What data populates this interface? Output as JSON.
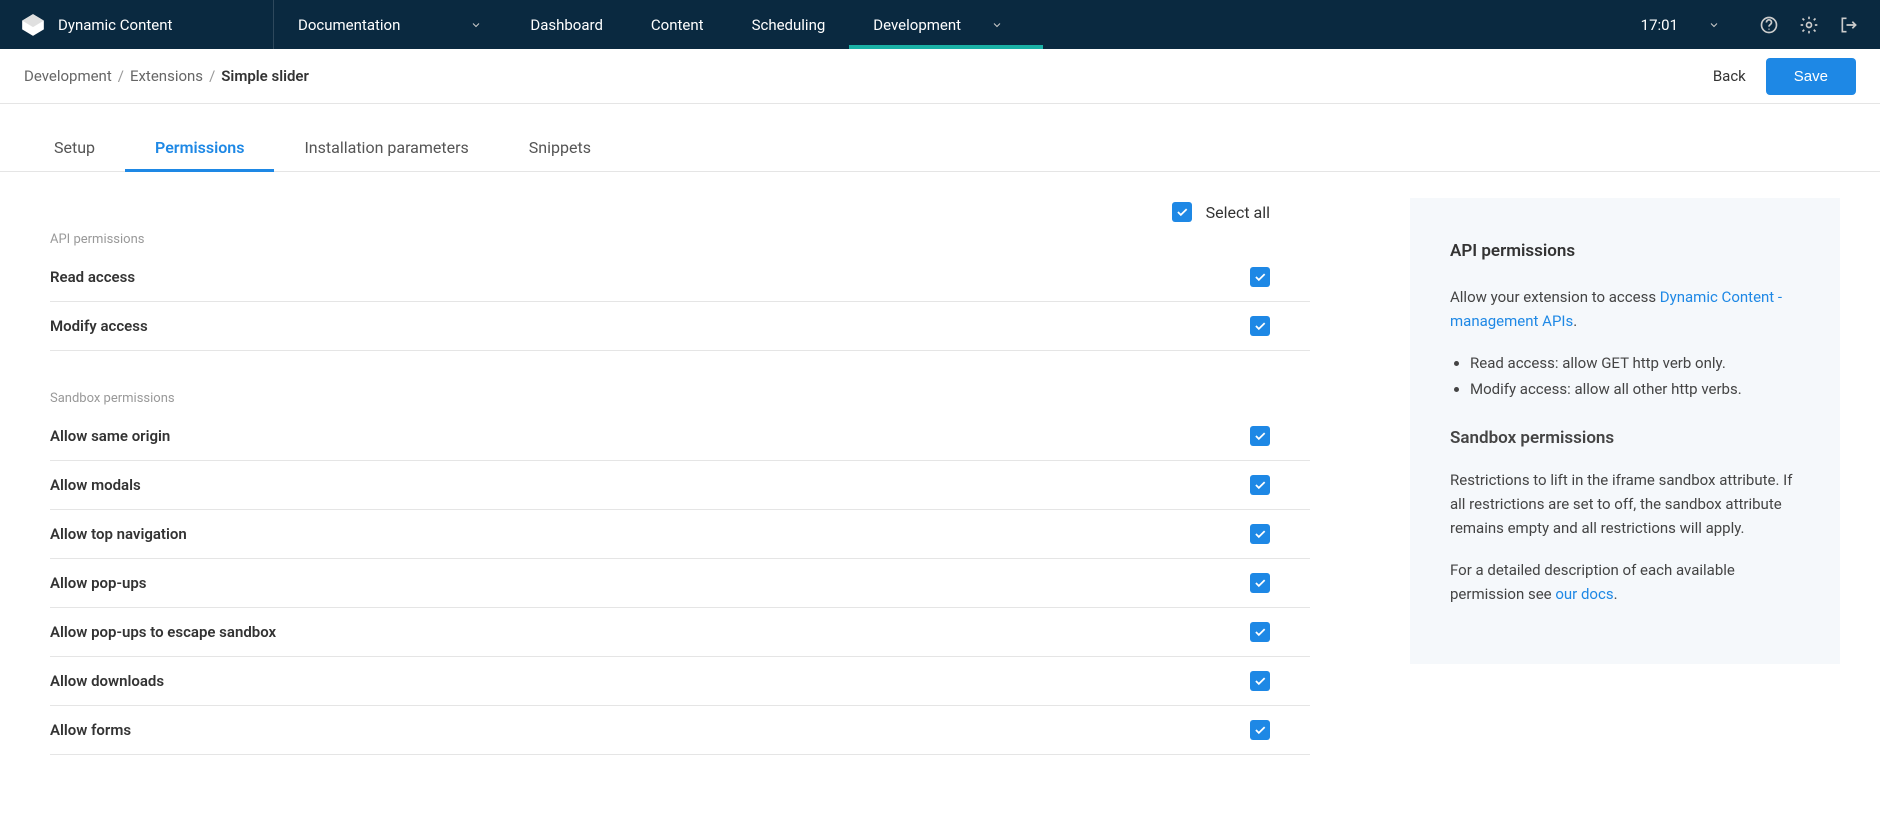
{
  "brand": "Dynamic Content",
  "docDropdown": "Documentation",
  "nav": {
    "items": [
      "Dashboard",
      "Content",
      "Scheduling",
      "Development"
    ],
    "activeIndex": 3
  },
  "time": "17:01",
  "breadcrumb": {
    "items": [
      "Development",
      "Extensions"
    ],
    "current": "Simple slider"
  },
  "actions": {
    "back": "Back",
    "save": "Save"
  },
  "tabs": {
    "items": [
      "Setup",
      "Permissions",
      "Installation parameters",
      "Snippets"
    ],
    "activeIndex": 1
  },
  "selectAll": "Select all",
  "apiSection": {
    "title": "API permissions",
    "items": [
      "Read access",
      "Modify access"
    ]
  },
  "sandboxSection": {
    "title": "Sandbox permissions",
    "items": [
      "Allow same origin",
      "Allow modals",
      "Allow top navigation",
      "Allow pop-ups",
      "Allow pop-ups to escape sandbox",
      "Allow downloads",
      "Allow forms"
    ]
  },
  "info": {
    "apiHeading": "API permissions",
    "apiDescPrefix": "Allow your extension to access ",
    "apiLink": "Dynamic Content - management APIs",
    "apiBullets": [
      "Read access: allow GET http verb only.",
      "Modify access: allow all other http verbs."
    ],
    "sandboxHeading": "Sandbox permissions",
    "sandboxDesc": "Restrictions to lift in the iframe sandbox attribute. If all restrictions are set to off, the sandbox attribute remains empty and all restrictions will apply.",
    "detailedDescPrefix": "For a detailed description of each available permission see ",
    "docsLink": "our docs"
  }
}
